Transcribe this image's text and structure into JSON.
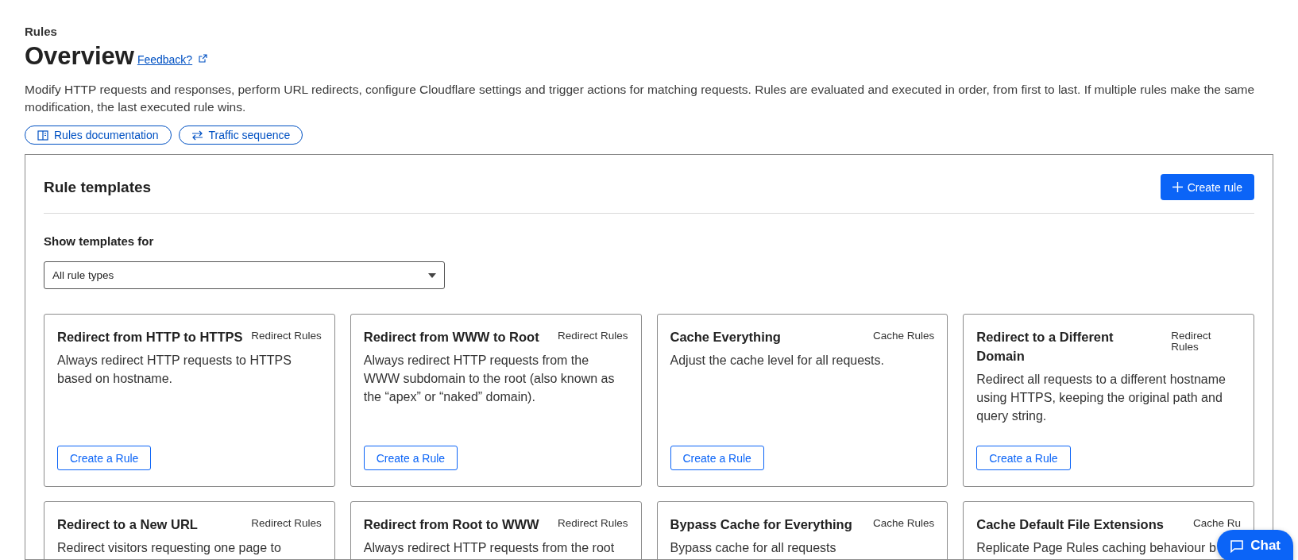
{
  "breadcrumb": "Rules",
  "title": "Overview",
  "feedback_link": "Feedback?",
  "description": "Modify HTTP requests and responses, perform URL redirects, configure Cloudflare settings and trigger actions for matching requests. Rules are evaluated and executed in order, from first to last. If multiple rules make the same modification, the last executed rule wins.",
  "links": [
    {
      "kind": "docs",
      "label": "Rules documentation"
    },
    {
      "kind": "sequence",
      "label": "Traffic sequence"
    }
  ],
  "panel": {
    "title": "Rule templates",
    "create_button": "Create rule",
    "filter_label": "Show templates for",
    "filter_value": "All rule types",
    "templates": [
      {
        "title": "Redirect from HTTP to HTTPS",
        "category": "Redirect Rules",
        "description": "Always redirect HTTP requests to HTTPS based on hostname.",
        "button": "Create a Rule"
      },
      {
        "title": "Redirect from WWW to Root",
        "category": "Redirect Rules",
        "description": "Always redirect HTTP requests from the WWW subdomain to the root (also known as the “apex” or “naked” domain).",
        "button": "Create a Rule"
      },
      {
        "title": "Cache Everything",
        "category": "Cache Rules",
        "description": "Adjust the cache level for all requests.",
        "button": "Create a Rule"
      },
      {
        "title": "Redirect to a Different Domain",
        "category": "Redirect Rules",
        "description": "Redirect all requests to a different hostname using HTTPS, keeping the original path and query string.",
        "button": "Create a Rule"
      },
      {
        "title": "Redirect to a New URL",
        "category": "Redirect Rules",
        "description": "Redirect visitors requesting one page to"
      },
      {
        "title": "Redirect from Root to WWW",
        "category": "Redirect Rules",
        "description": "Always redirect HTTP requests from the root"
      },
      {
        "title": "Bypass Cache for Everything",
        "category": "Cache Rules",
        "description": "Bypass cache for all requests"
      },
      {
        "title": "Cache Default File Extensions",
        "category": "Cache Ru",
        "description": "Replicate Page Rules caching behaviour b"
      }
    ]
  },
  "chat_button": "Chat"
}
